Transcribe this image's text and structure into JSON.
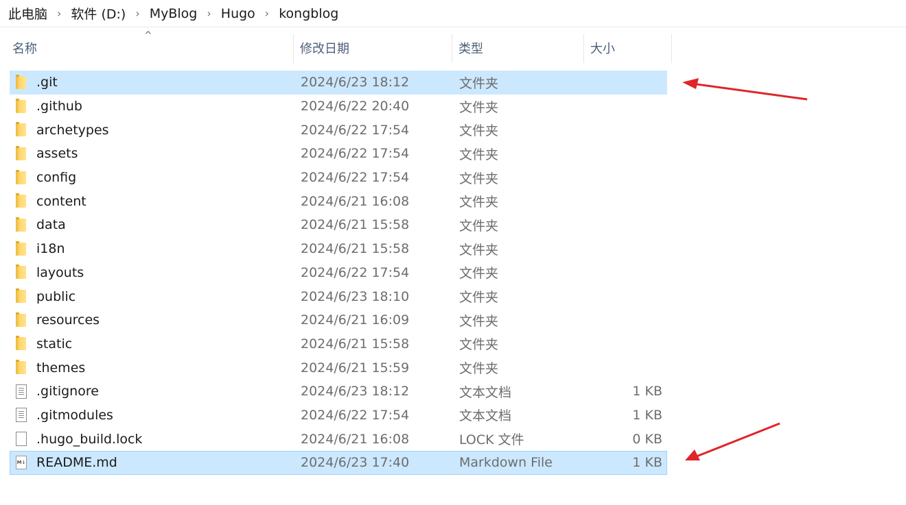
{
  "breadcrumb": [
    "此电脑",
    "软件 (D:)",
    "MyBlog",
    "Hugo",
    "kongblog"
  ],
  "columns": {
    "name": "名称",
    "date": "修改日期",
    "type": "类型",
    "size": "大小"
  },
  "sort_indicator": "^",
  "files": [
    {
      "name": ".git",
      "date": "2024/6/23 18:12",
      "type": "文件夹",
      "size": "",
      "icon": "folder-icon",
      "selected": true
    },
    {
      "name": ".github",
      "date": "2024/6/22 20:40",
      "type": "文件夹",
      "size": "",
      "icon": "folder-icon"
    },
    {
      "name": "archetypes",
      "date": "2024/6/22 17:54",
      "type": "文件夹",
      "size": "",
      "icon": "folder-icon"
    },
    {
      "name": "assets",
      "date": "2024/6/22 17:54",
      "type": "文件夹",
      "size": "",
      "icon": "folder-icon"
    },
    {
      "name": "config",
      "date": "2024/6/22 17:54",
      "type": "文件夹",
      "size": "",
      "icon": "folder-icon"
    },
    {
      "name": "content",
      "date": "2024/6/21 16:08",
      "type": "文件夹",
      "size": "",
      "icon": "folder-icon"
    },
    {
      "name": "data",
      "date": "2024/6/21 15:58",
      "type": "文件夹",
      "size": "",
      "icon": "folder-icon"
    },
    {
      "name": "i18n",
      "date": "2024/6/21 15:58",
      "type": "文件夹",
      "size": "",
      "icon": "folder-icon"
    },
    {
      "name": "layouts",
      "date": "2024/6/22 17:54",
      "type": "文件夹",
      "size": "",
      "icon": "folder-icon"
    },
    {
      "name": "public",
      "date": "2024/6/23 18:10",
      "type": "文件夹",
      "size": "",
      "icon": "folder-icon"
    },
    {
      "name": "resources",
      "date": "2024/6/21 16:09",
      "type": "文件夹",
      "size": "",
      "icon": "folder-icon"
    },
    {
      "name": "static",
      "date": "2024/6/21 15:58",
      "type": "文件夹",
      "size": "",
      "icon": "folder-icon"
    },
    {
      "name": "themes",
      "date": "2024/6/21 15:59",
      "type": "文件夹",
      "size": "",
      "icon": "folder-icon"
    },
    {
      "name": ".gitignore",
      "date": "2024/6/23 18:12",
      "type": "文本文档",
      "size": "1 KB",
      "icon": "text-file-icon"
    },
    {
      "name": ".gitmodules",
      "date": "2024/6/22 17:54",
      "type": "文本文档",
      "size": "1 KB",
      "icon": "text-file-icon"
    },
    {
      "name": ".hugo_build.lock",
      "date": "2024/6/21 16:08",
      "type": "LOCK 文件",
      "size": "0 KB",
      "icon": "blank-file-icon"
    },
    {
      "name": "README.md",
      "date": "2024/6/23 17:40",
      "type": "Markdown File",
      "size": "1 KB",
      "icon": "markdown-file-icon",
      "selected": true
    }
  ],
  "colors": {
    "selection": "#cce8ff",
    "selection_border": "#99d1ff",
    "header_text": "#4c607a",
    "annotation_arrow": "#e0242a"
  },
  "md_icon_text": "M↓"
}
